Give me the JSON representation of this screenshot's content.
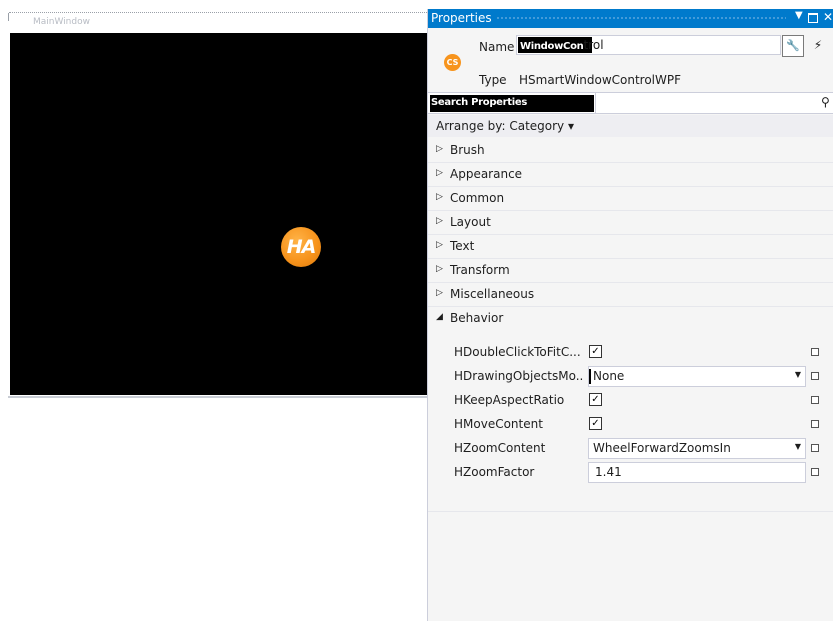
{
  "designer": {
    "window_title": "MainWindow",
    "logo_text": "HA"
  },
  "properties": {
    "title": "Properties",
    "name_label": "Name",
    "name_value_highlight": "WindowCon",
    "name_value_rest": "trol",
    "type_label": "Type",
    "type_value": "HSmartWindowControlWPF",
    "object_icon_text": "CS",
    "search_placeholder": "Search Properties",
    "arrange_by": "Arrange by: Category ▾",
    "icons": {
      "wrench": "wrench-icon",
      "bolt": "lightning-icon",
      "search": "search-icon",
      "dropdown": "chevron-down-icon",
      "close": "close-icon"
    },
    "categories": [
      {
        "label": "Brush",
        "expanded": false
      },
      {
        "label": "Appearance",
        "expanded": false
      },
      {
        "label": "Common",
        "expanded": false
      },
      {
        "label": "Layout",
        "expanded": false
      },
      {
        "label": "Text",
        "expanded": false
      },
      {
        "label": "Transform",
        "expanded": false
      },
      {
        "label": "Miscellaneous",
        "expanded": false
      },
      {
        "label": "Behavior",
        "expanded": true
      }
    ],
    "behavior": [
      {
        "name": "HDoubleClickToFitC...",
        "kind": "checkbox",
        "checked": true
      },
      {
        "name": "HDrawingObjectsMo...",
        "kind": "select",
        "value": "None"
      },
      {
        "name": "HKeepAspectRatio",
        "kind": "checkbox",
        "checked": true
      },
      {
        "name": "HMoveContent",
        "kind": "checkbox",
        "checked": true
      },
      {
        "name": "HZoomContent",
        "kind": "select",
        "value": "WheelForwardZoomsIn"
      },
      {
        "name": "HZoomFactor",
        "kind": "text",
        "value": "1.41"
      }
    ]
  },
  "colors": {
    "titlebar": "#007acc",
    "panel_bg": "#f5f5f5",
    "logo_orange": "#f7941d"
  }
}
